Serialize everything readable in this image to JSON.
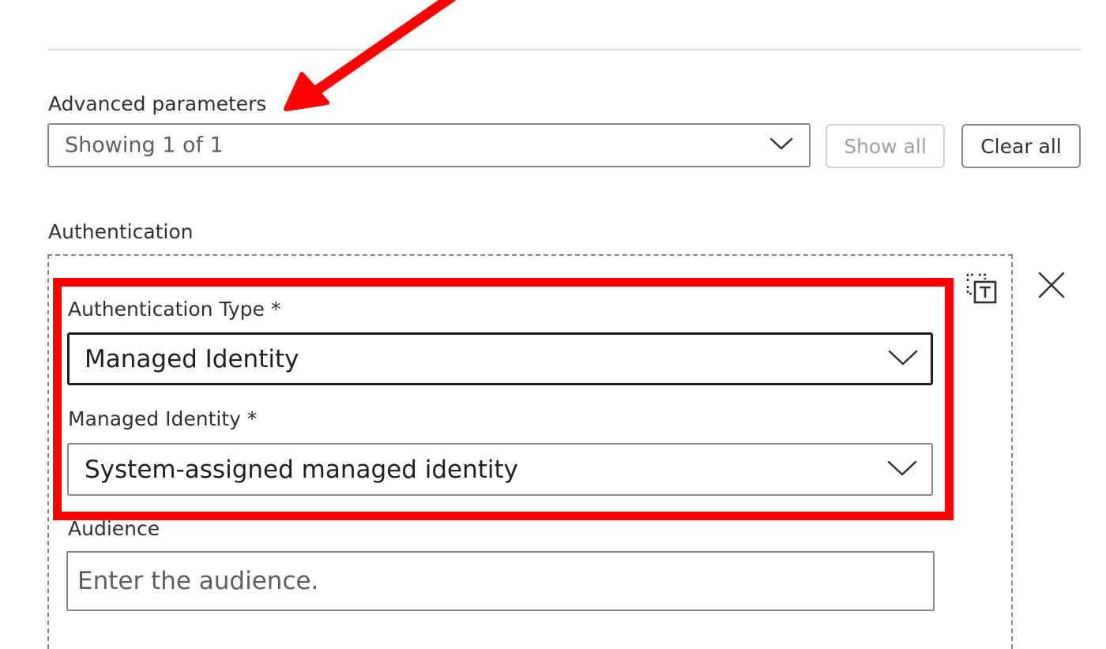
{
  "advanced_parameters": {
    "label": "Advanced parameters",
    "selected_value": "Showing 1 of 1",
    "chevron_icon": "chevron-down-icon",
    "show_all_label": "Show all",
    "clear_all_label": "Clear all"
  },
  "authentication": {
    "section_label": "Authentication",
    "token_icon": "dynamic-content-token-icon",
    "close_icon": "close-icon",
    "type": {
      "label": "Authentication Type *",
      "selected_value": "Managed Identity"
    },
    "managed_identity": {
      "label": "Managed Identity *",
      "selected_value": "System-assigned managed identity"
    },
    "audience": {
      "label": "Audience",
      "value": "",
      "placeholder": "Enter the audience."
    }
  },
  "annotation": {
    "color": "#ff0000"
  }
}
